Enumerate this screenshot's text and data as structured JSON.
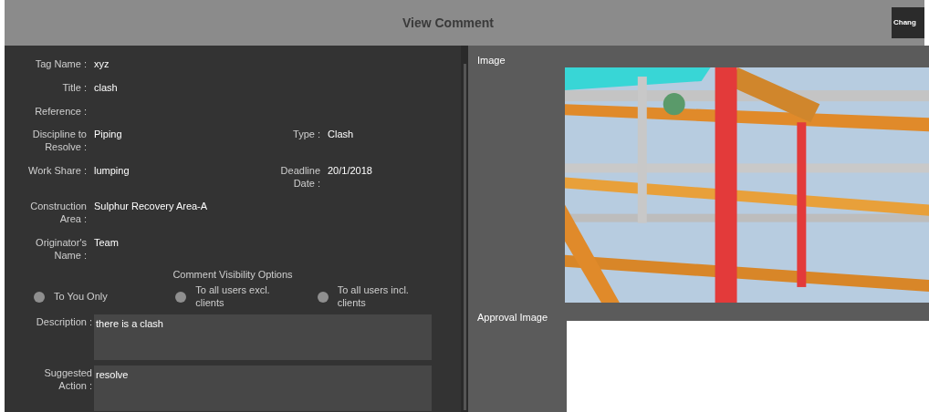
{
  "header": {
    "title": "View Comment",
    "button": "Chang"
  },
  "fields": [
    {
      "label": "Tag Name :",
      "value": "xyz"
    },
    {
      "label": "Title :",
      "value": "clash"
    },
    {
      "label": "Reference :"
    }
  ],
  "pairs": [
    {
      "left": {
        "label": "Discipline to Resolve :",
        "value": "Piping"
      },
      "right": {
        "label": "Type :",
        "value": "Clash"
      }
    },
    {
      "left": {
        "label": "Work Share :",
        "value": "lumping"
      },
      "right": {
        "label": "Deadline Date :",
        "value": "20/1/2018"
      }
    }
  ],
  "fields2": [
    {
      "label": "Construction Area :",
      "value": "Sulphur Recovery Area-A"
    },
    {
      "label": "Originator's Name :",
      "value": "Team"
    }
  ],
  "visibility": {
    "title": "Comment Visibility Options",
    "options": [
      {
        "label": "To You Only",
        "selected": false
      },
      {
        "label": "To all users excl. clients",
        "selected": false
      },
      {
        "label": "To all users incl. clients",
        "selected": false
      }
    ]
  },
  "text_areas": [
    {
      "label": "Description :",
      "value": "there is a clash"
    },
    {
      "label": "Suggested Action :",
      "value": "resolve"
    }
  ],
  "image_section": {
    "label": "Image"
  },
  "approval_section": {
    "label": "Approval Image"
  }
}
